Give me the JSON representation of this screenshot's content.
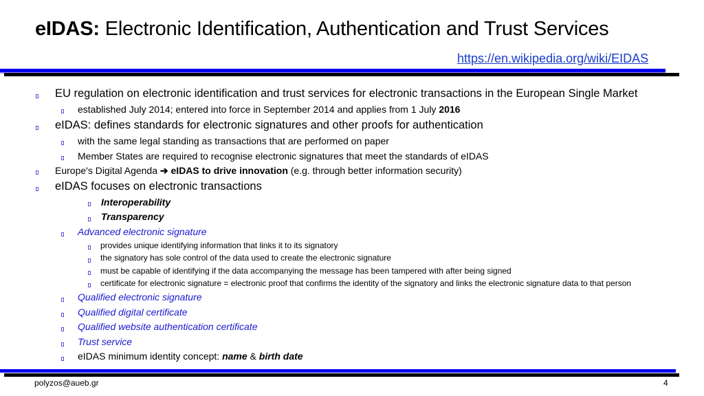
{
  "header": {
    "title_bold": "eIDAS:",
    "title_rest": " Electronic Identification, Authentication and Trust Services",
    "link": "https://en.wikipedia.org/wiki/EIDAS"
  },
  "bullets": {
    "b1": "EU regulation on electronic identification and trust services for electronic transactions in the European Single Market",
    "b1_1_text": "established July 2014; entered into force in September 2014 and applies from 1 July ",
    "b1_1_bold": "2016",
    "b2": "eIDAS: defines standards for electronic signatures and other proofs for authentication",
    "b2_1": "with the same legal standing as transactions that are performed on paper",
    "b2_2": "Member States are required to recognise electronic signatures that meet the standards of eIDAS",
    "b3_pre": "Europe's Digital Agenda ",
    "b3_arrow": "➔",
    "b3_bold": " eIDAS to drive innovation",
    "b3_post": " (e.g. through better information security)",
    "b4": "eIDAS focuses on electronic transactions",
    "b4_1": "Interoperability",
    "b4_2": "Transparency",
    "b4_3": "Advanced electronic signature",
    "b4_3_1": "provides unique identifying information that links it to its signatory",
    "b4_3_2": "the signatory has sole control of the data used to create the electronic signature",
    "b4_3_3": "must be capable of identifying if the data accompanying the message has been tampered with after being signed",
    "b4_3_4": "certificate for electronic signature = electronic proof that confirms the identity of the signatory and links the electronic signature data to that person",
    "b4_4": "Qualified electronic signature",
    "b4_5": "Qualified digital certificate",
    "b4_6": "Qualified website authentication certificate",
    "b4_7": "Trust service",
    "b4_8_pre": "eIDAS minimum identity concept: ",
    "b4_8_name": "name",
    "b4_8_amp": " & ",
    "b4_8_birth": "birth date"
  },
  "footer": {
    "email": "polyzos@aueb.gr",
    "page": "4"
  },
  "colors": {
    "rule_blue": "#0000ee",
    "link_blue": "#1a3ccc",
    "term_blue": "#1a1ad0",
    "bullet": "#5b4fd8"
  }
}
